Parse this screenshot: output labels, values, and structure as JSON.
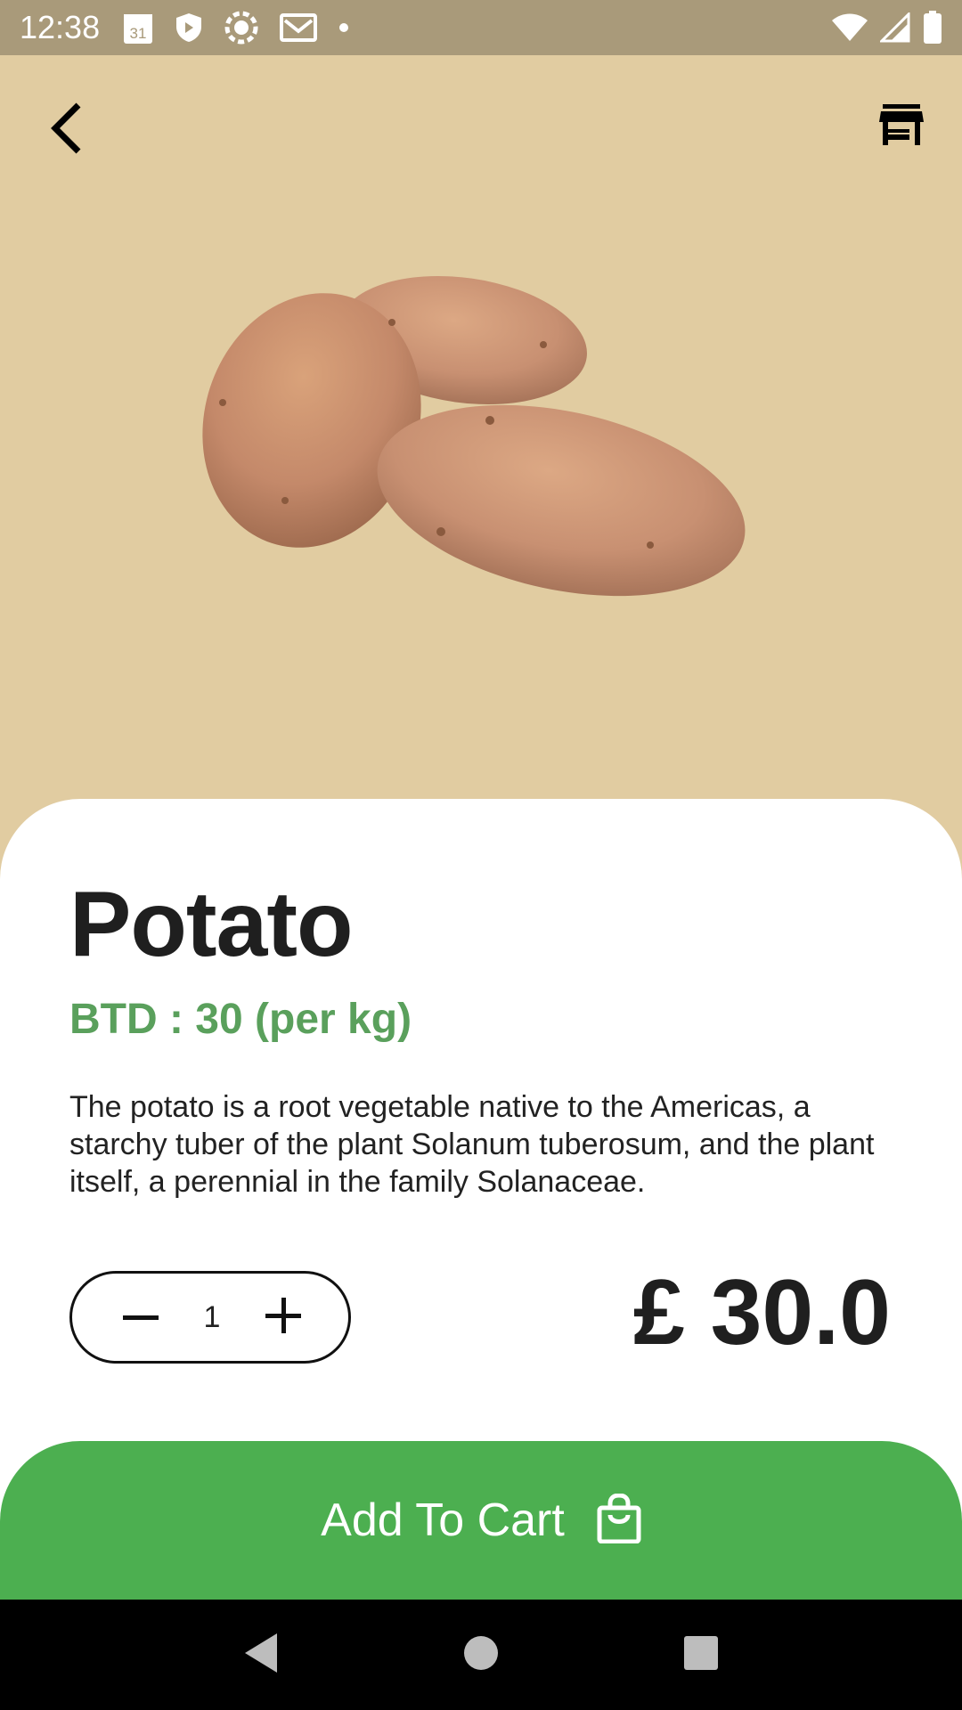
{
  "status_bar": {
    "time": "12:38",
    "calendar_day": "31",
    "left_icons": [
      "calendar-icon",
      "shield-icon",
      "settings-icon",
      "mail-icon",
      "dot-icon"
    ],
    "right_icons": [
      "wifi-icon",
      "signal-icon",
      "battery-icon"
    ]
  },
  "header": {
    "back_icon": "chevron-left-icon",
    "store_icon": "store-icon"
  },
  "product": {
    "name": "Potato",
    "unit_price": "BTD : 30 (per kg)",
    "description": "The potato is a root vegetable native to the Americas, a starchy tuber of the plant Solanum tuberosum, and the plant itself, a perennial in the family Solanaceae.",
    "quantity": "1",
    "total": "£ 30.0"
  },
  "cart": {
    "label": "Add To Cart",
    "icon": "shopping-bag-icon"
  },
  "colors": {
    "hero_bg": "#e1cca1",
    "status_bg": "#a99a7a",
    "accent_green": "#4caf50",
    "price_green": "#5aa05c"
  }
}
